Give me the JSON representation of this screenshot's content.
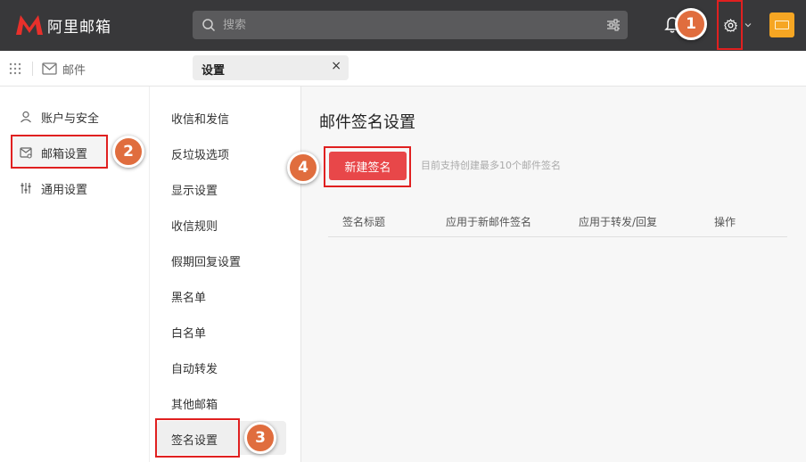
{
  "app": {
    "brand": "阿里邮箱"
  },
  "search": {
    "placeholder": "搜索"
  },
  "tabs": {
    "mail_label": "邮件",
    "active_label": "设置",
    "close_glyph": "×"
  },
  "left_nav": {
    "items": [
      {
        "label": "账户与安全",
        "icon": "user-icon"
      },
      {
        "label": "邮箱设置",
        "icon": "mailbox-settings-icon"
      },
      {
        "label": "通用设置",
        "icon": "sliders-icon"
      }
    ]
  },
  "mid_nav": {
    "items": [
      "收信和发信",
      "反垃圾选项",
      "显示设置",
      "收信规则",
      "假期回复设置",
      "黑名单",
      "白名单",
      "自动转发",
      "其他邮箱",
      "签名设置"
    ]
  },
  "content": {
    "title": "邮件签名设置",
    "new_button": "新建签名",
    "hint": "目前支持创建最多10个邮件签名",
    "columns": [
      "签名标题",
      "应用于新邮件签名",
      "应用于转发/回复",
      "操作"
    ]
  },
  "badges": [
    "1",
    "2",
    "3",
    "4"
  ],
  "colors": {
    "topbar": "#38383a",
    "accent": "#e84749",
    "highlight": "#e02020",
    "badge": "#e06d3e",
    "app_tile": "#f6a623"
  }
}
